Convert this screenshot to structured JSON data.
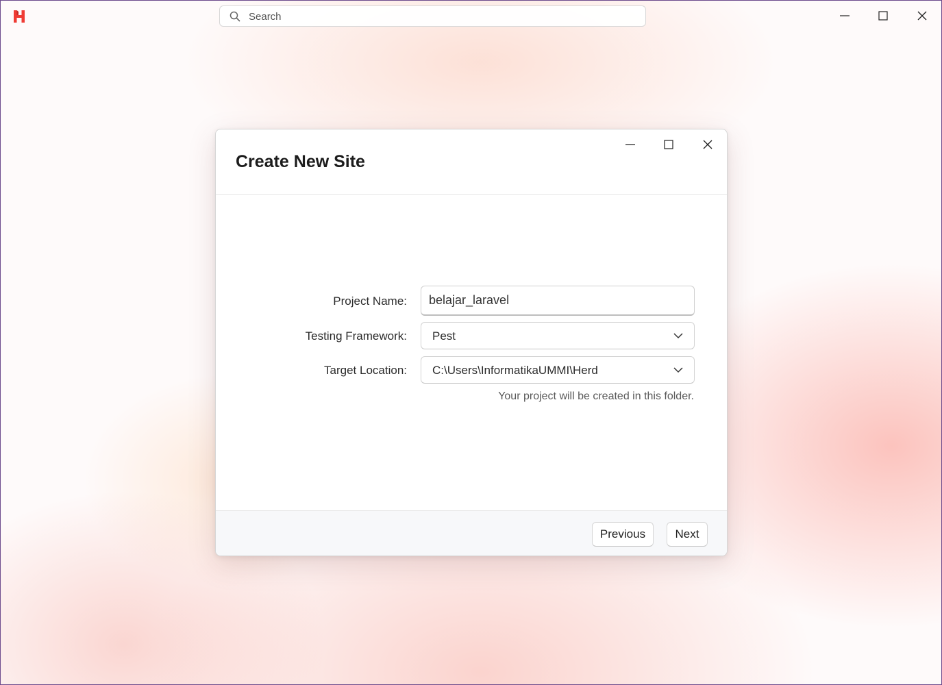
{
  "titlebar": {
    "search": {
      "placeholder": "Search"
    },
    "window_controls": [
      "minimize",
      "maximize",
      "close"
    ]
  },
  "dialog": {
    "title": "Create New Site",
    "window_controls": [
      "minimize",
      "maximize",
      "close"
    ],
    "form": {
      "project_name": {
        "label": "Project Name:",
        "value": "belajar_laravel"
      },
      "testing_framework": {
        "label": "Testing Framework:",
        "value": "Pest"
      },
      "target_location": {
        "label": "Target Location:",
        "value": "C:\\Users\\InformatikaUMMI\\Herd",
        "hint": "Your project will be created in this folder."
      }
    },
    "footer": {
      "previous_label": "Previous",
      "next_label": "Next"
    }
  },
  "colors": {
    "brand": "#ef3b34",
    "accent_background": "#f8b4ac"
  },
  "icons": {
    "app_logo": "herd-logo-icon",
    "search": "search-icon",
    "chevron": "chevron-down-icon"
  }
}
